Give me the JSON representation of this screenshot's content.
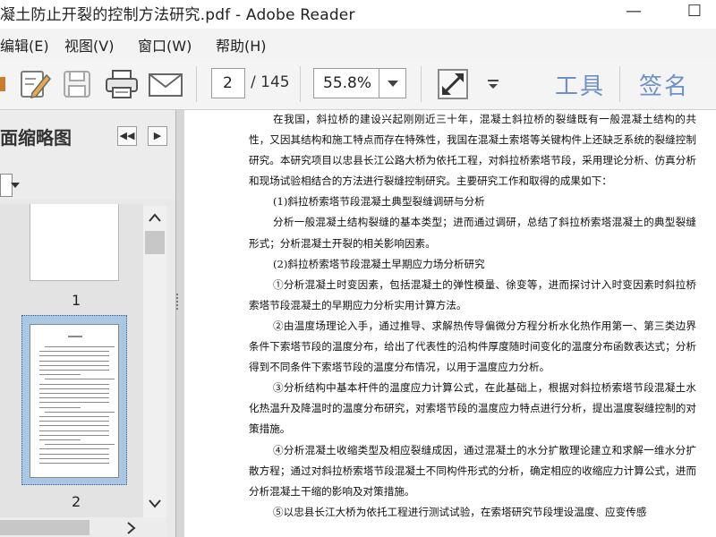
{
  "window": {
    "title": "凝土防止开裂的控制方法研究.pdf - Adobe Reader",
    "minimize_glyph": "—",
    "maximize_glyph": "☐"
  },
  "menu": [
    "编辑(E)",
    "视图(V)",
    "窗口(W)",
    "帮助(H)"
  ],
  "toolbar": {
    "current_page": "2",
    "page_count": "/ 145",
    "zoom": "55.8%",
    "tools_label": "工具",
    "sign_label": "签名",
    "icons": [
      "edit-sign-icon",
      "save-icon",
      "print-icon",
      "email-icon",
      "fullscreen-icon",
      "more-options-icon"
    ]
  },
  "sidebar": {
    "title": "面缩略图",
    "prev_glyph": "◀◀",
    "next_glyph": "▶",
    "thumbnails": [
      {
        "label": "1"
      },
      {
        "label": "2",
        "selected": true
      }
    ]
  },
  "document": {
    "paragraphs": [
      {
        "indent": true,
        "text": "在我国，斜拉桥的建设兴起刚刚近三十年，混凝土斜拉桥的裂缝既有一般混凝土结构的共性，又因其结构和施工特点而存在特殊性，我国在混凝土索塔等关键构件上还缺乏系统的裂缝控制研究。本研究项目以忠县长江公路大桥为依托工程，对斜拉桥索塔节段，采用理论分析、仿真分析和现场试验相结合的方法进行裂缝控制研究。主要研究工作和取得的成果如下："
      },
      {
        "indent": true,
        "text": "(1)斜拉桥索塔节段混凝土典型裂缝调研与分析"
      },
      {
        "indent": true,
        "text": "分析一般混凝土结构裂缝的基本类型；进而通过调研，总结了斜拉桥索塔混凝土的典型裂缝形式；分析混凝土开裂的相关影响因素。"
      },
      {
        "indent": true,
        "text": "(2)斜拉桥索塔节段混凝土早期应力场分析研究"
      },
      {
        "indent": true,
        "text": "①分析混凝土时变因素，包括混凝土的弹性模量、徐变等，进而探讨计入时变因素时斜拉桥索塔节段混凝土的早期应力分析实用计算方法。"
      },
      {
        "indent": true,
        "text": "②由温度场理论入手，通过推导、求解热传导偏微分方程分析水化热作用第一、第三类边界条件下索塔节段的温度分布，给出了代表性的沿构件厚度随时间变化的温度分布函数表达式；分析得到不同条件下索塔节段的温度分布情况，以用于温度应力分析。"
      },
      {
        "indent": true,
        "text": "③分析结构中基本杆件的温度应力计算公式，在此基础上，根据对斜拉桥索塔节段混凝土水化热温升及降温时的温度分布研究，对索塔节段的温度应力特点进行分析，提出温度裂缝控制的对策措施。"
      },
      {
        "indent": true,
        "text": "④分析混凝土收缩类型及相应裂缝成因，通过混凝土的水分扩散理论建立和求解一维水分扩散方程；通过对斜拉桥索塔节段混凝土不同构件形式的分析，确定相应的收缩应力计算公式，进而分析混凝土干缩的影响及对策措施。"
      },
      {
        "indent": true,
        "text": "⑤以忠县长江大桥为依托工程进行测试试验，在索塔研究节段埋设温度、应变传感"
      }
    ]
  }
}
